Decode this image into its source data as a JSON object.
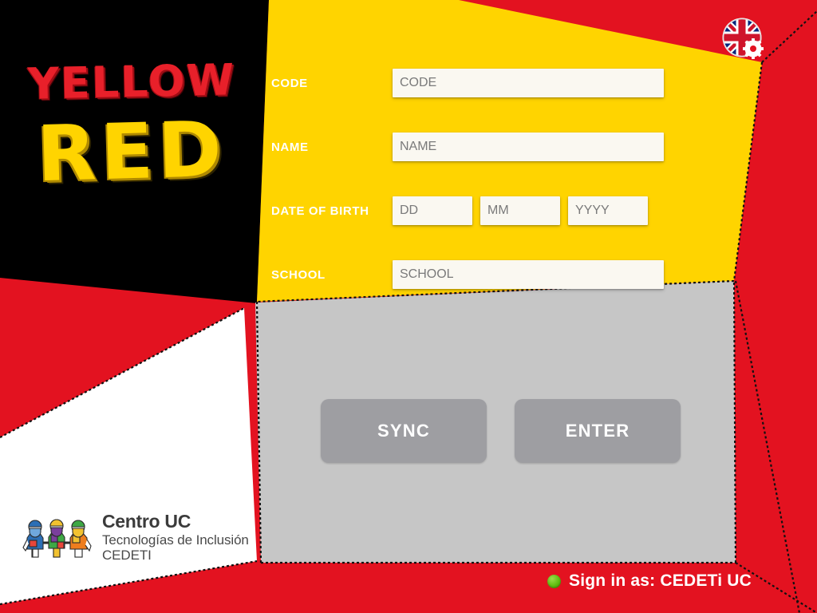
{
  "app": {
    "logo_word_top": "YELLOW",
    "logo_word_bottom": "RED"
  },
  "colors": {
    "red": "#E31220",
    "yellow": "#FFD400",
    "black": "#000000",
    "white": "#FFFFFF",
    "grey_panel": "#C6C6C6",
    "button_grey": "#9E9EA2",
    "field_bg": "#FAF8F1",
    "status_green": "#5FBD10"
  },
  "form": {
    "rows": [
      {
        "label": "CODE",
        "placeholder": "CODE"
      },
      {
        "label": "NAME",
        "placeholder": "NAME"
      },
      {
        "label": "DATE OF BIRTH",
        "placeholder_day": "DD",
        "placeholder_month": "MM",
        "placeholder_year": "YYYY"
      },
      {
        "label": "SCHOOL",
        "placeholder": "SCHOOL"
      }
    ],
    "values": {
      "code": "",
      "name": "",
      "day": "",
      "month": "",
      "year": "",
      "school": ""
    }
  },
  "actions": {
    "sync_label": "SYNC",
    "enter_label": "ENTER"
  },
  "language_button": {
    "icon": "uk-flag-icon",
    "overlay_icon": "gear-icon",
    "flag": "United Kingdom"
  },
  "cedeti": {
    "icon": "three-figures-icon",
    "line1": "Centro UC",
    "line2": "Tecnologías de Inclusión",
    "line3": "CEDETI"
  },
  "status": {
    "dot": "online-status-dot",
    "text": "Sign in as: CEDETi UC"
  }
}
